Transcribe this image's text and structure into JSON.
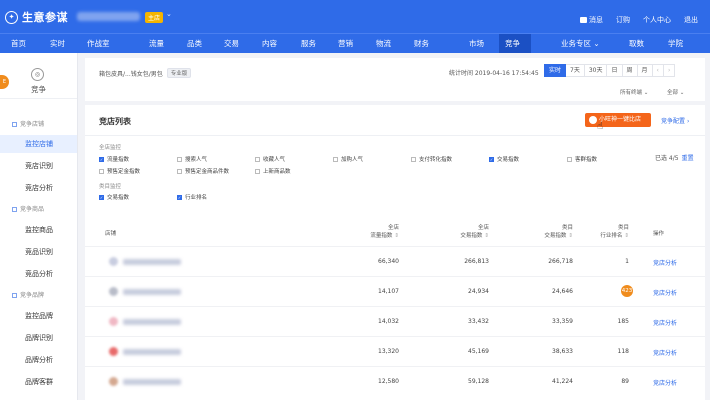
{
  "header": {
    "logo_icon": "compass-icon",
    "app_title": "生意参谋",
    "shop_badge": "主店",
    "links": [
      "消息",
      "订购",
      "个人中心",
      "退出"
    ]
  },
  "nav": {
    "items": [
      {
        "label": "首页"
      },
      {
        "label": "实时"
      },
      {
        "label": "作战室"
      },
      {
        "label": "流量"
      },
      {
        "label": "品类",
        "dot": true
      },
      {
        "label": "交易"
      },
      {
        "label": "内容"
      },
      {
        "label": "服务",
        "dot": true
      },
      {
        "label": "营销"
      },
      {
        "label": "物流",
        "dot": true
      },
      {
        "label": "财务"
      },
      {
        "label": "市场"
      },
      {
        "label": "竞争",
        "active": true
      },
      {
        "label": "业务专区",
        "dropdown": true
      },
      {
        "label": "取数"
      },
      {
        "label": "学院"
      }
    ]
  },
  "sidebar": {
    "title": "竞争",
    "flag": "E",
    "groups": [
      {
        "label": "竞争店铺",
        "items": [
          "监控店铺",
          "竞店识别",
          "竞店分析"
        ]
      },
      {
        "label": "竞争商品",
        "items": [
          "监控商品",
          "竞品识别",
          "竞品分析"
        ]
      },
      {
        "label": "竞争品牌",
        "items": [
          "监控品牌",
          "品牌识别",
          "品牌分析",
          "品牌客群"
        ]
      }
    ],
    "active_item": "监控店铺"
  },
  "filters": {
    "breadcrumb": "箱包皮具/...钱女包/男包",
    "level_badge": "专业版",
    "stat_time": "统计时间 2019-04-16 17:54:45",
    "range_tabs": [
      "实时",
      "7天",
      "30天",
      "日",
      "周",
      "月"
    ],
    "active_range": "实时",
    "terminal": "所有终端",
    "scope": "全部"
  },
  "card": {
    "title": "竞店列表",
    "compare_button": "小旺神一键比店",
    "config_link": "竞争配置",
    "shop_monitor_label": "全店监控",
    "shop_metrics": [
      {
        "label": "流量指数",
        "checked": true
      },
      {
        "label": "搜索人气",
        "checked": false
      },
      {
        "label": "收藏人气",
        "checked": false
      },
      {
        "label": "加购人气",
        "checked": false
      },
      {
        "label": "支付转化指数",
        "checked": false
      },
      {
        "label": "交易指数",
        "checked": true
      },
      {
        "label": "客群指数",
        "checked": false
      },
      {
        "label": "预售定金指数",
        "checked": false
      },
      {
        "label": "预售定金商品件数",
        "checked": false
      },
      {
        "label": "上新商品数",
        "checked": false
      }
    ],
    "category_monitor_label": "类目监控",
    "category_metrics": [
      {
        "label": "交易指数",
        "checked": true
      },
      {
        "label": "行业排名",
        "checked": true
      }
    ],
    "selected_count": "已选 4/5",
    "reset": "重置"
  },
  "table": {
    "headers": {
      "shop": "店铺",
      "c1": [
        "全店",
        "流量指数"
      ],
      "c2": [
        "全店",
        "交易指数"
      ],
      "c3": [
        "类目",
        "交易指数"
      ],
      "c4": [
        "类目",
        "行业排名"
      ],
      "op": "操作"
    },
    "rows": [
      {
        "traffic": "66,340",
        "trade": "266,813",
        "cat_trade": "266,718",
        "rank": "1",
        "badge": false,
        "avatar_color": "#c8cde0",
        "action": "竞店分析"
      },
      {
        "traffic": "14,107",
        "trade": "24,934",
        "cat_trade": "24,646",
        "rank": "423",
        "badge": true,
        "avatar_color": "#b8bcc8",
        "action": "竞店分析"
      },
      {
        "traffic": "14,032",
        "trade": "33,432",
        "cat_trade": "33,359",
        "rank": "185",
        "badge": false,
        "avatar_color": "#f0b8c4",
        "action": "竞店分析"
      },
      {
        "traffic": "13,320",
        "trade": "45,169",
        "cat_trade": "38,633",
        "rank": "118",
        "badge": false,
        "avatar_color": "#e86a6a",
        "action": "竞店分析"
      },
      {
        "traffic": "12,580",
        "trade": "59,128",
        "cat_trade": "41,224",
        "rank": "89",
        "badge": false,
        "avatar_color": "#d4a890",
        "action": "竞店分析"
      }
    ]
  },
  "colors": {
    "primary": "#2f6be8",
    "accent_orange": "#f4651a",
    "badge_yellow": "#f5b400"
  }
}
